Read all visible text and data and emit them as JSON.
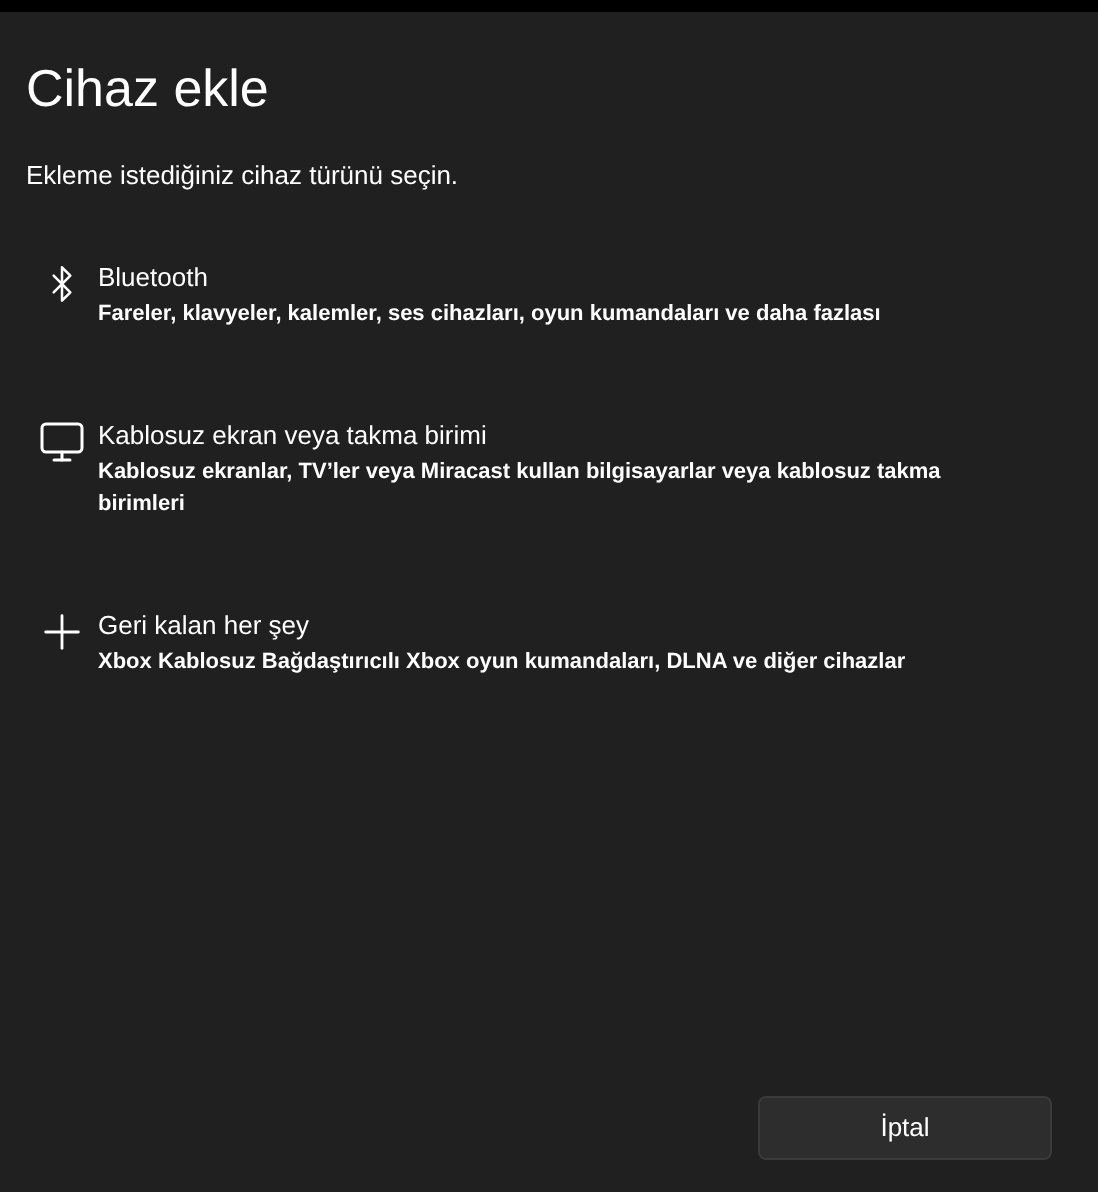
{
  "window": {
    "title": "Cihaz ekle",
    "subtitle": "Ekleme istediğiniz cihaz türünü seçin."
  },
  "device_types": [
    {
      "title": "Bluetooth",
      "description": "Fareler, klavyeler, kalemler, ses cihazları, oyun kumandaları ve daha fazlası"
    },
    {
      "title": "Kablosuz ekran veya takma birimi",
      "description": "Kablosuz ekranlar, TV’ler veya Miracast kullan bilgisayarlar veya kablosuz takma birimleri"
    },
    {
      "title": "Geri kalan her şey",
      "description": "Xbox Kablosuz Bağdaştırıcılı Xbox oyun kumandaları, DLNA ve diğer cihazlar"
    }
  ],
  "buttons": [
    "İptal"
  ]
}
